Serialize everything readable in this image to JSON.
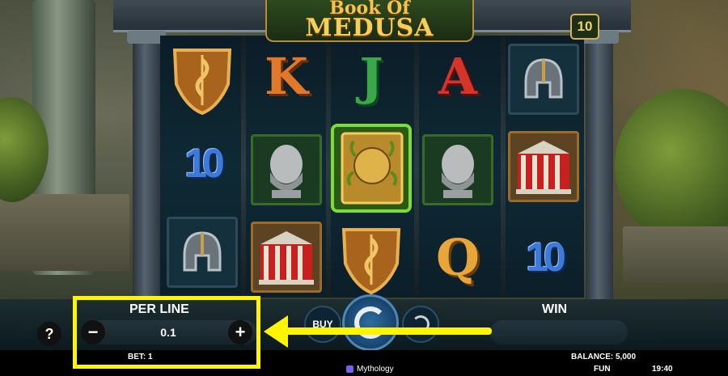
{
  "game": {
    "logo_line1": "Book Of",
    "logo_line2": "MEDUSA",
    "lines_count": "10"
  },
  "reels": [
    [
      "shield-symbol",
      "ten-symbol",
      "helmet-symbol"
    ],
    [
      "k-symbol",
      "statue-symbol",
      "temple-symbol"
    ],
    [
      "j-symbol",
      "book-of-medusa-symbol",
      "shield-symbol"
    ],
    [
      "a-symbol",
      "statue-symbol",
      "q-symbol"
    ],
    [
      "helmet-symbol",
      "temple-symbol",
      "ten-symbol"
    ]
  ],
  "symbol_text": {
    "ten": "10",
    "k": "K",
    "j": "J",
    "a": "A",
    "q": "Q"
  },
  "controls": {
    "per_line_label": "PER LINE",
    "per_line_value": "0.1",
    "minus": "−",
    "plus": "+",
    "help": "?",
    "buy_label": "BUY",
    "win_label": "WIN",
    "win_value": ""
  },
  "status": {
    "bet": "BET: 1",
    "balance": "BALANCE: 5,000",
    "mode": "FUN",
    "time": "19:40",
    "provider": "Mythology"
  },
  "colors": {
    "annotation": "#fff500",
    "gold": "#f4d360"
  }
}
